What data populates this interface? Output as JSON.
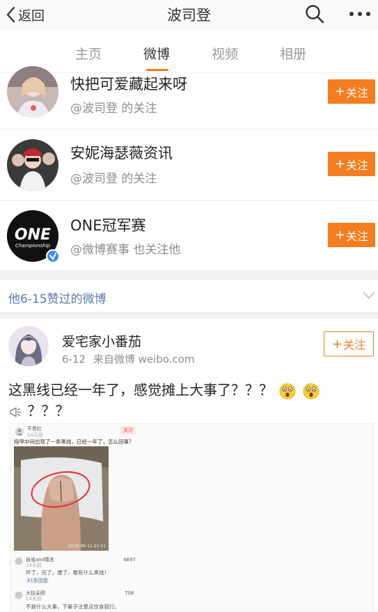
{
  "header": {
    "back_label": "返回",
    "title": "波司登"
  },
  "tabs": [
    {
      "label": "主页"
    },
    {
      "label": "微博"
    },
    {
      "label": "视频"
    },
    {
      "label": "相册"
    }
  ],
  "follows": [
    {
      "name": "快把可爱藏起来呀",
      "sub": "@波司登 的关注",
      "button": "关注"
    },
    {
      "name": "安妮海瑟薇资讯",
      "sub": "@波司登 的关注",
      "button": "关注"
    },
    {
      "name": "ONE冠军赛",
      "sub": "@微博赛事 也关注他",
      "button": "关注",
      "verified": true,
      "logo_text": "ONE",
      "logo_sub": "Championship"
    }
  ],
  "section": {
    "title": "他6-15赞过的微博"
  },
  "post": {
    "author": "爱宅家小番茄",
    "date": "6-12",
    "source": "来自微博 weibo.com",
    "follow_label": "关注",
    "text_line1": "这黑线已经一年了，感觉摊上大事了？？？",
    "text_line2": "？？？",
    "screenshot": {
      "user": "不秀红",
      "time": "14天前",
      "follow": "关注",
      "question": "指甲中间出现了一条黑线，已经一年了，怎么回事？",
      "photo_date": "2018-06-11 21:51",
      "comment1_user": "自省and慎言",
      "comment1_time": "14天前",
      "comment1_likes": "4697",
      "comment1_text": "坏了，完了，遭了，哪有什么黑线！",
      "comment1_replies": "41条回复",
      "comment2_user": "大扶朵颐",
      "comment2_time": "14天前",
      "comment2_likes": "708",
      "comment2_text": "不是什么大事，下辈子注意点饮食就行。"
    }
  },
  "colors": {
    "accent": "#f47d20",
    "link": "#5b7ba6",
    "verified": "#3b8ee8"
  }
}
